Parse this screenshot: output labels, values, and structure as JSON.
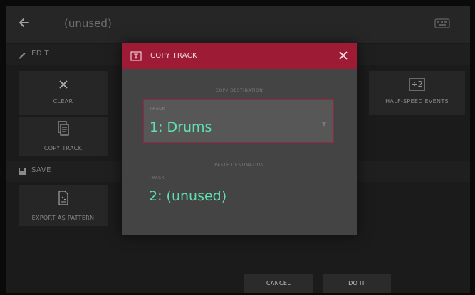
{
  "header": {
    "back_icon": "arrow-left-icon",
    "track_title": "(unused)",
    "right_icon": "keyboard-icon"
  },
  "sections": {
    "edit_label": "EDIT",
    "save_label": "SAVE"
  },
  "tiles": {
    "clear": "CLEAR",
    "copy_track": "COPY TRACK",
    "export_as_pattern": "EXPORT AS PATTERN",
    "half_speed_events": "HALF-SPEED EVENTS",
    "half_speed_badge": "÷2"
  },
  "modal": {
    "title": "COPY TRACK",
    "source_caption": "COPY DESTINATION",
    "source_field_label": "TRACK",
    "source_value": "1: Drums",
    "dest_caption": "PASTE DESTINATION",
    "dest_field_label": "TRACK",
    "dest_value": "2: (unused)"
  },
  "buttons": {
    "cancel": "CANCEL",
    "do_it": "DO IT"
  },
  "colors": {
    "accent_red": "#9e1b36",
    "value_green": "#5ee0b0"
  }
}
